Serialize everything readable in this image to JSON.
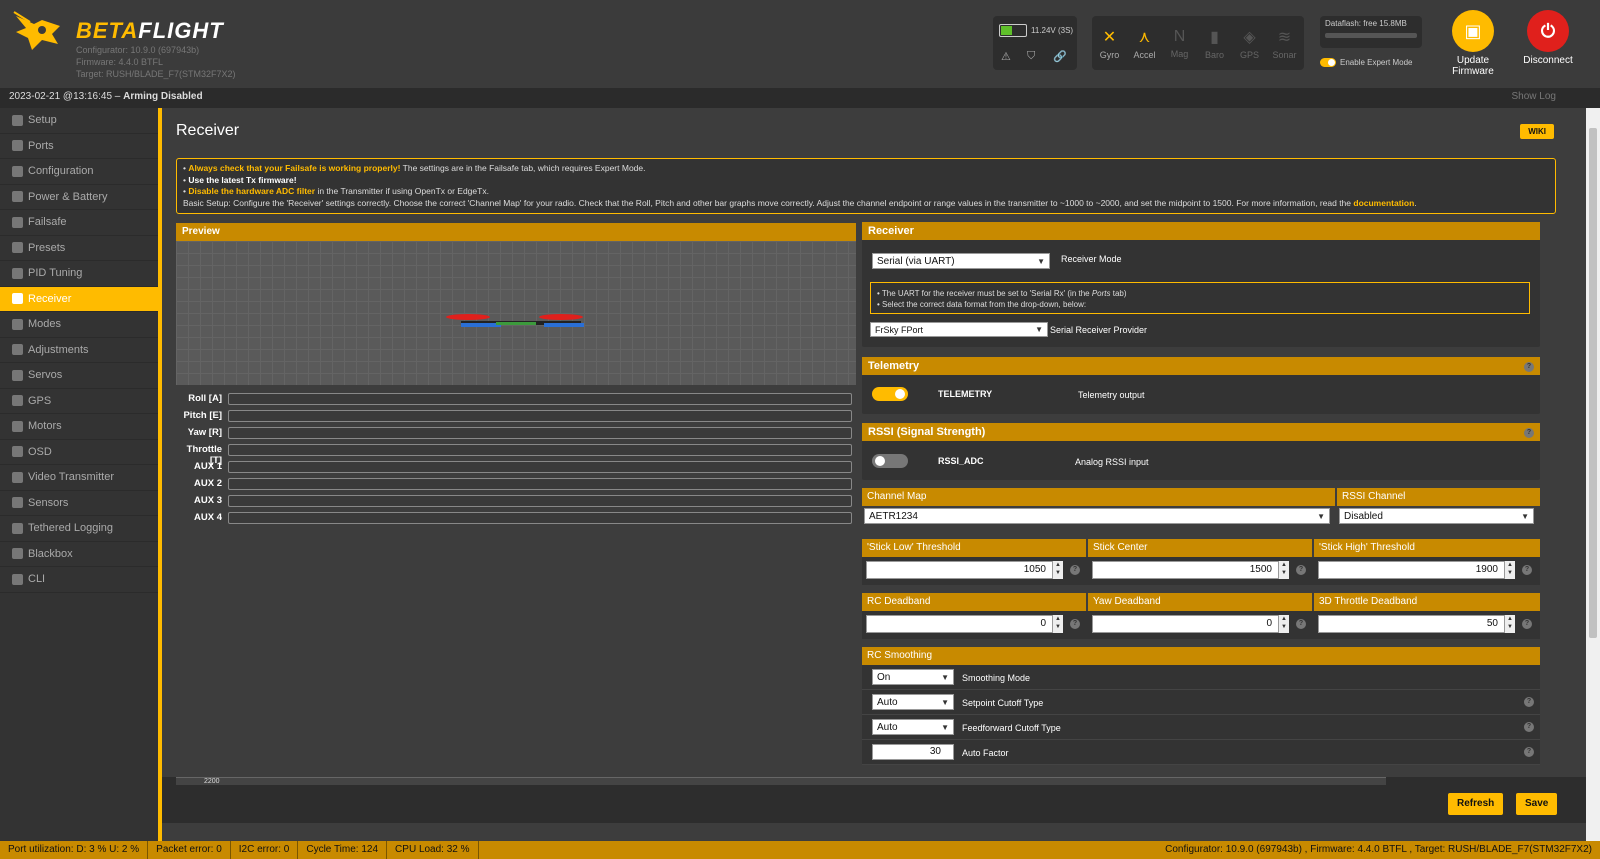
{
  "header": {
    "brand_prefix": "BETA",
    "brand_suffix": "FLIGHT",
    "configurator": "Configurator: 10.9.0 (697943b)",
    "firmware": "Firmware: 4.4.0 BTFL",
    "target": "Target: RUSH/BLADE_F7(STM32F7X2)",
    "battery": "11.24V (3S)",
    "battery_fill": 0.45,
    "sensors": [
      {
        "label": "Gyro",
        "active": true
      },
      {
        "label": "Accel",
        "active": true
      },
      {
        "label": "Mag",
        "active": false
      },
      {
        "label": "Baro",
        "active": false
      },
      {
        "label": "GPS",
        "active": false
      },
      {
        "label": "Sonar",
        "active": false
      }
    ],
    "dataflash": "Dataflash: free 15.8MB",
    "expert_mode": "Enable Expert Mode",
    "update_label_1": "Update",
    "update_label_2": "Firmware",
    "disconnect_label": "Disconnect"
  },
  "logbar": {
    "timestamp": "2023-02-21 @13:16:45 – ",
    "status": "Arming Disabled",
    "show_log": "Show Log"
  },
  "sidebar": {
    "items": [
      {
        "label": "Setup"
      },
      {
        "label": "Ports"
      },
      {
        "label": "Configuration"
      },
      {
        "label": "Power & Battery"
      },
      {
        "label": "Failsafe"
      },
      {
        "label": "Presets"
      },
      {
        "label": "PID Tuning"
      },
      {
        "label": "Receiver",
        "active": true
      },
      {
        "label": "Modes"
      },
      {
        "label": "Adjustments"
      },
      {
        "label": "Servos"
      },
      {
        "label": "GPS"
      },
      {
        "label": "Motors"
      },
      {
        "label": "OSD"
      },
      {
        "label": "Video Transmitter"
      },
      {
        "label": "Sensors"
      },
      {
        "label": "Tethered Logging"
      },
      {
        "label": "Blackbox"
      },
      {
        "label": "CLI"
      }
    ]
  },
  "main": {
    "title": "Receiver",
    "wiki": "WIKI",
    "notes": {
      "n1_bold": "Always check that your Failsafe is working properly!",
      "n1_rest": " The settings are in the Failsafe tab, which requires Expert Mode.",
      "n2": "Use the latest Tx firmware!",
      "n3_bold": "Disable the hardware ADC filter",
      "n3_rest": " in the Transmitter if using OpenTx or EdgeTx.",
      "n4": "Basic Setup: Configure the 'Receiver' settings correctly. Choose the correct 'Channel Map' for your radio. Check that the Roll, Pitch and other bar graphs move correctly. Adjust the channel endpoint or range values in the transmitter to ~1000 to ~2000, and set the midpoint to 1500. For more information, read the ",
      "n4_link": "documentation",
      "n4_end": "."
    },
    "preview_title": "Preview",
    "channels": [
      "Roll [A]",
      "Pitch [E]",
      "Yaw [R]",
      "Throttle [T]",
      "AUX 1",
      "AUX 2",
      "AUX 3",
      "AUX 4"
    ],
    "receiver": {
      "title": "Receiver",
      "mode_value": "Serial (via UART)",
      "mode_label": "Receiver Mode",
      "note1": "• The UART for the receiver must be set to 'Serial Rx' (in the ",
      "note1_em": "Ports",
      "note1_end": " tab)",
      "note2": "• Select the correct data format from the drop-down, below:",
      "provider_value": "FrSky FPort",
      "provider_label": "Serial Receiver Provider"
    },
    "telemetry": {
      "title": "Telemetry",
      "name": "TELEMETRY",
      "desc": "Telemetry output",
      "enabled": true
    },
    "rssi": {
      "title": "RSSI (Signal Strength)",
      "name": "RSSI_ADC",
      "desc": "Analog RSSI input",
      "enabled": false
    },
    "channel_map": {
      "label": "Channel Map",
      "value": "AETR1234",
      "rssi_label": "RSSI Channel",
      "rssi_value": "Disabled"
    },
    "sticks": {
      "low_label": "'Stick Low' Threshold",
      "low": "1050",
      "center_label": "Stick Center",
      "center": "1500",
      "high_label": "'Stick High' Threshold",
      "high": "1900"
    },
    "deadband": {
      "rc_label": "RC Deadband",
      "rc": "0",
      "yaw_label": "Yaw Deadband",
      "yaw": "0",
      "thr_label": "3D Throttle Deadband",
      "thr": "50"
    },
    "smoothing": {
      "title": "RC Smoothing",
      "rows": [
        {
          "value": "On",
          "label": "Smoothing Mode"
        },
        {
          "value": "Auto",
          "label": "Setpoint Cutoff Type"
        },
        {
          "value": "Auto",
          "label": "Feedforward Cutoff Type"
        },
        {
          "value": "30",
          "label": "Auto Factor"
        }
      ]
    },
    "graph_tick": "2200",
    "refresh": "Refresh",
    "save": "Save"
  },
  "statusbar": {
    "port": "Port utilization: D: 3 % U: 2 %",
    "packet": "Packet error: 0",
    "i2c": "I2C error: 0",
    "cycle": "Cycle Time: 124",
    "cpu": "CPU Load: 32 %",
    "right": "Configurator: 10.9.0 (697943b) , Firmware: 4.4.0 BTFL , Target: RUSH/BLADE_F7(STM32F7X2)"
  }
}
